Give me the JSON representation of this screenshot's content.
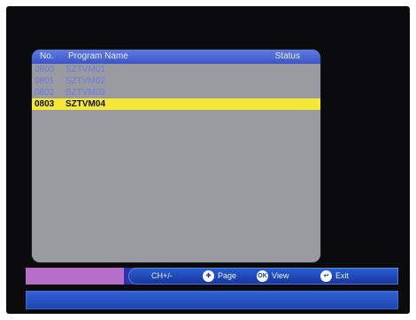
{
  "program_list": {
    "headers": {
      "no": "No.",
      "program_name": "Program Name",
      "status": "Status"
    },
    "rows": [
      {
        "no": "0800",
        "name": "SZTVM01",
        "status": ""
      },
      {
        "no": "0801",
        "name": "SZTVM02",
        "status": ""
      },
      {
        "no": "0802",
        "name": "SZTVM03",
        "status": ""
      },
      {
        "no": "0803",
        "name": "SZTVM04",
        "status": ""
      }
    ],
    "selected_index": 3
  },
  "help_bar": {
    "ch_label": "CH+/-",
    "page_label": "Page",
    "view_label": "View",
    "exit_label": "Exit"
  },
  "icons": {
    "page_icon": "page-icon",
    "view_icon": "ok-icon",
    "exit_icon": "exit-icon"
  },
  "colors": {
    "screen_background": "#0b0b0d",
    "panel_background": "#9a9ba1",
    "header_blue": "#3b56c6",
    "row_text_blue": "#6c79e6",
    "selected_row": "#f3e838",
    "help_left_purple": "#b66ec8",
    "help_bar_blue": "#2d33ab"
  }
}
